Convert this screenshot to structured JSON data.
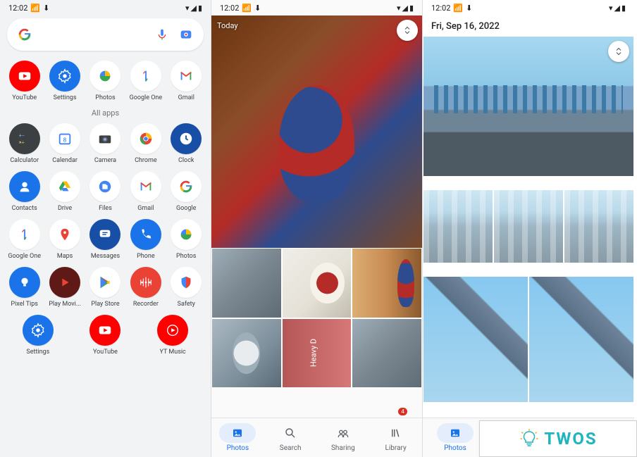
{
  "status": {
    "time": "12:02",
    "icons": [
      "lte-icon",
      "download-icon",
      "wifi-icon",
      "signal-icon",
      "battery-icon"
    ]
  },
  "panel1": {
    "fav_row": [
      {
        "label": "YouTube",
        "icon": "youtube-icon",
        "wrap": "bg-red"
      },
      {
        "label": "Settings",
        "icon": "gear-icon",
        "wrap": "bg-blue"
      },
      {
        "label": "Photos",
        "icon": "photos-icon",
        "wrap": ""
      },
      {
        "label": "Google One",
        "icon": "googleone-icon",
        "wrap": ""
      },
      {
        "label": "Gmail",
        "icon": "gmail-icon",
        "wrap": ""
      }
    ],
    "all_apps_label": "All apps",
    "rows": [
      [
        {
          "label": "Calculator",
          "icon": "calculator-icon",
          "wrap": "bg-dark"
        },
        {
          "label": "Calendar",
          "icon": "calendar-icon",
          "wrap": ""
        },
        {
          "label": "Camera",
          "icon": "camera-icon",
          "wrap": ""
        },
        {
          "label": "Chrome",
          "icon": "chrome-icon",
          "wrap": ""
        },
        {
          "label": "Clock",
          "icon": "clock-icon",
          "wrap": "bg-darkblue"
        }
      ],
      [
        {
          "label": "Contacts",
          "icon": "contacts-icon",
          "wrap": "bg-blue"
        },
        {
          "label": "Drive",
          "icon": "drive-icon",
          "wrap": ""
        },
        {
          "label": "Files",
          "icon": "files-icon",
          "wrap": ""
        },
        {
          "label": "Gmail",
          "icon": "gmail-icon",
          "wrap": ""
        },
        {
          "label": "Google",
          "icon": "google-g-icon",
          "wrap": ""
        }
      ],
      [
        {
          "label": "Google One",
          "icon": "googleone-icon",
          "wrap": ""
        },
        {
          "label": "Maps",
          "icon": "maps-icon",
          "wrap": ""
        },
        {
          "label": "Messages",
          "icon": "messages-icon",
          "wrap": "bg-darkblue"
        },
        {
          "label": "Phone",
          "icon": "phone-icon",
          "wrap": "bg-blue"
        },
        {
          "label": "Photos",
          "icon": "photos-icon",
          "wrap": ""
        }
      ],
      [
        {
          "label": "Pixel Tips",
          "icon": "tips-icon",
          "wrap": "bg-blue"
        },
        {
          "label": "Play Movi...",
          "icon": "playmovies-icon",
          "wrap": "bg-maroon"
        },
        {
          "label": "Play Store",
          "icon": "playstore-icon",
          "wrap": ""
        },
        {
          "label": "Recorder",
          "icon": "recorder-icon",
          "wrap": "bg-redcircle"
        },
        {
          "label": "Safety",
          "icon": "safety-icon",
          "wrap": ""
        }
      ],
      [
        {
          "label": "Settings",
          "icon": "gear-icon",
          "wrap": "bg-blue"
        },
        {
          "label": "YouTube",
          "icon": "youtube-icon",
          "wrap": "bg-red"
        },
        {
          "label": "YT Music",
          "icon": "ytmusic-icon",
          "wrap": "bg-red"
        }
      ]
    ]
  },
  "panel2": {
    "overlay": "Today",
    "nav": [
      {
        "label": "Photos",
        "icon": "photo-nav-icon",
        "active": true
      },
      {
        "label": "Search",
        "icon": "search-icon",
        "active": false
      },
      {
        "label": "Sharing",
        "icon": "sharing-icon",
        "active": false
      },
      {
        "label": "Library",
        "icon": "library-icon",
        "active": false,
        "badge": "4"
      }
    ]
  },
  "panel3": {
    "date": "Fri, Sep 16, 2022",
    "nav": [
      {
        "label": "Photos",
        "icon": "photo-nav-icon",
        "active": true
      }
    ]
  },
  "watermark": {
    "text": "TWOS"
  }
}
